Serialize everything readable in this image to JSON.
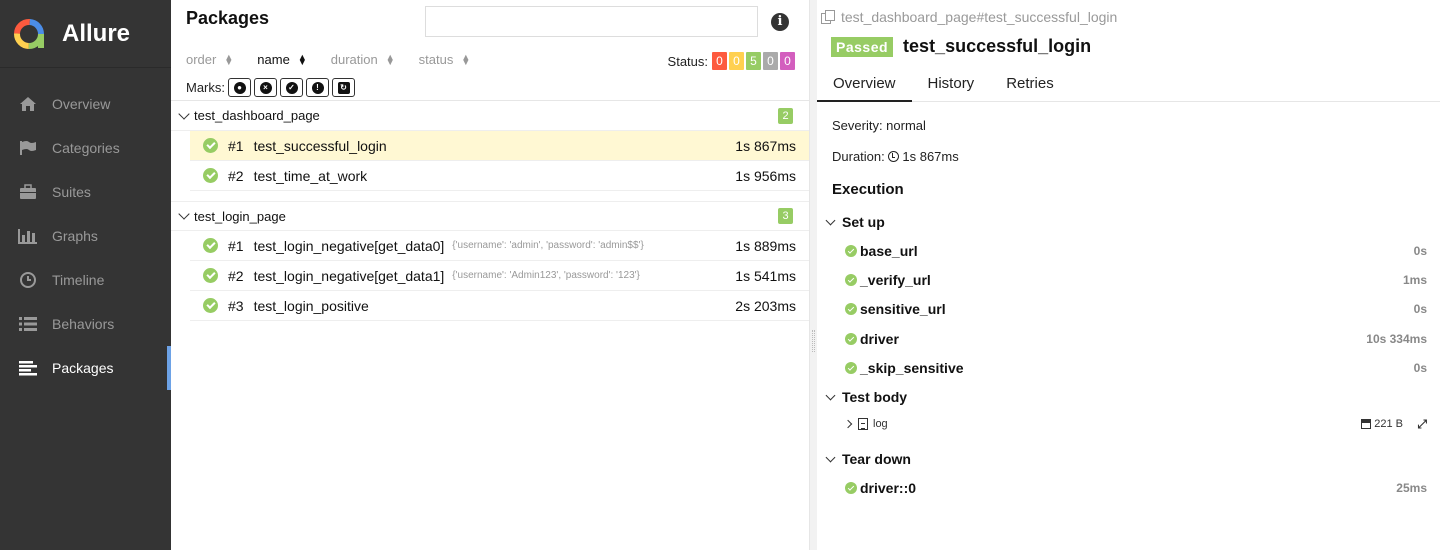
{
  "app": {
    "brand": "Allure"
  },
  "sidebar": {
    "items": [
      {
        "label": "Overview",
        "icon": "home-icon"
      },
      {
        "label": "Categories",
        "icon": "flag-icon"
      },
      {
        "label": "Suites",
        "icon": "briefcase-icon"
      },
      {
        "label": "Graphs",
        "icon": "bar-chart-icon"
      },
      {
        "label": "Timeline",
        "icon": "clock-icon"
      },
      {
        "label": "Behaviors",
        "icon": "list-icon"
      },
      {
        "label": "Packages",
        "icon": "align-left-icon",
        "active": true
      }
    ]
  },
  "packages": {
    "title": "Packages",
    "search": {
      "value": "",
      "placeholder": ""
    },
    "sort": {
      "order": "order",
      "name": "name",
      "duration": "duration",
      "status": "status",
      "active": "name"
    },
    "status_label": "Status:",
    "status_counts": [
      {
        "value": "0",
        "color": "#fd5a3e"
      },
      {
        "value": "0",
        "color": "#ffd050"
      },
      {
        "value": "5",
        "color": "#97cc64"
      },
      {
        "value": "0",
        "color": "#aaaaaa"
      },
      {
        "value": "0",
        "color": "#d35ebe"
      }
    ],
    "marks_label": "Marks:",
    "groups": [
      {
        "name": "test_dashboard_page",
        "count": "2",
        "rows": [
          {
            "num": "#1",
            "name": "test_successful_login",
            "params": "",
            "duration": "1s 867ms",
            "selected": true
          },
          {
            "num": "#2",
            "name": "test_time_at_work",
            "params": "",
            "duration": "1s 956ms"
          }
        ]
      },
      {
        "name": "test_login_page",
        "count": "3",
        "rows": [
          {
            "num": "#1",
            "name": "test_login_negative[get_data0]",
            "params": "{'username': 'admin', 'password': 'admin$$'}",
            "duration": "1s 889ms"
          },
          {
            "num": "#2",
            "name": "test_login_negative[get_data1]",
            "params": "{'username': 'Admin123', 'password': '123'}",
            "duration": "1s 541ms"
          },
          {
            "num": "#3",
            "name": "test_login_positive",
            "params": "",
            "duration": "2s 203ms"
          }
        ]
      }
    ]
  },
  "detail": {
    "breadcrumb": "test_dashboard_page#test_successful_login",
    "status": "Passed",
    "status_color": "#97cc64",
    "title": "test_successful_login",
    "tabs": [
      "Overview",
      "History",
      "Retries"
    ],
    "severity": "Severity: normal",
    "duration_label": "Duration:",
    "duration": "1s 867ms",
    "execution_title": "Execution",
    "setup": {
      "label": "Set up",
      "steps": [
        {
          "name": "base_url",
          "duration": "0s"
        },
        {
          "name": "_verify_url",
          "duration": "1ms"
        },
        {
          "name": "sensitive_url",
          "duration": "0s"
        },
        {
          "name": "driver",
          "duration": "10s 334ms"
        },
        {
          "name": "_skip_sensitive",
          "duration": "0s"
        }
      ]
    },
    "body": {
      "label": "Test body",
      "attachment": {
        "name": "log",
        "size": "221 B"
      }
    },
    "teardown": {
      "label": "Tear down",
      "steps": [
        {
          "name": "driver::0",
          "duration": "25ms"
        }
      ]
    }
  }
}
